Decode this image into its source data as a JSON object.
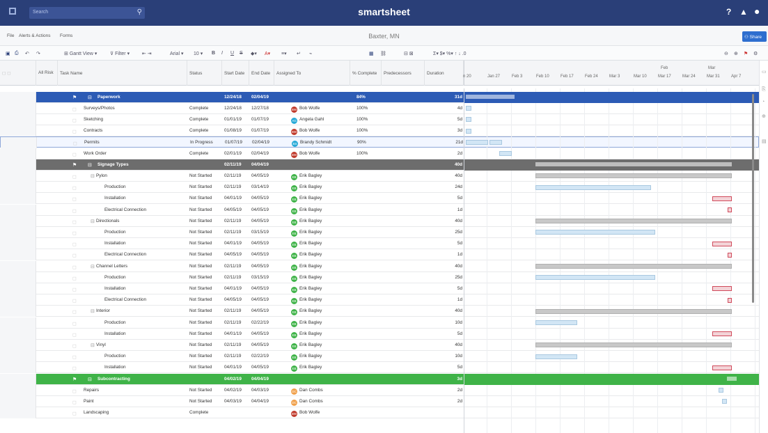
{
  "topbar": {
    "search_placeholder": "Search",
    "app_name": "smartsheet",
    "icons": [
      "grid-icon",
      "search-icon",
      "help-icon",
      "bell-icon",
      "profile-icon"
    ]
  },
  "menu": {
    "items": [
      "File",
      "Alerts & Actions",
      "Forms"
    ],
    "sheet_title": "Baxter, MN",
    "share_label": "Share"
  },
  "toolbar": {
    "gantt_view": "Gantt View",
    "filter": "Filter",
    "font": "Arial",
    "font_size": "10"
  },
  "columns": [
    "All Risk",
    "Task Name",
    "Status",
    "Start Date",
    "End Date",
    "Assigned To",
    "% Complete",
    "Predecessors",
    "Duration"
  ],
  "gantt_header": {
    "months": [
      "Feb",
      "Mar"
    ],
    "weeks": [
      "n 20",
      "Jan 27",
      "Feb 3",
      "Feb 10",
      "Feb 17",
      "Feb 24",
      "Mar 3",
      "Mar 10",
      "Mar 17",
      "Mar 24",
      "Mar 31",
      "Apr 7"
    ]
  },
  "rows": [
    {
      "type": "p1",
      "name": "Paperwork",
      "status": "",
      "start": "12/24/18",
      "end": "02/04/19",
      "assigned": "",
      "pct": "84%",
      "dur": "31d"
    },
    {
      "type": "c",
      "name": "Surveys/Photos",
      "status": "Complete",
      "start": "12/24/18",
      "end": "12/27/18",
      "assigned": "Bob Wolfe",
      "avc": "#c0392b",
      "pct": "100%",
      "dur": "4d"
    },
    {
      "type": "c",
      "name": "Sketching",
      "status": "Complete",
      "start": "01/01/19",
      "end": "01/07/19",
      "assigned": "Angela Gahl",
      "avc": "#27a9d7",
      "pct": "100%",
      "dur": "5d"
    },
    {
      "type": "c",
      "name": "Contracts",
      "status": "Complete",
      "start": "01/08/19",
      "end": "01/07/19",
      "assigned": "Bob Wolfe",
      "avc": "#c0392b",
      "pct": "100%",
      "dur": "3d"
    },
    {
      "type": "c",
      "sel": true,
      "name": "Permits",
      "status": "In Progress",
      "start": "01/07/19",
      "end": "02/04/19",
      "assigned": "Brandy Schmidt",
      "avc": "#27a9d7",
      "pct": "90%",
      "dur": "21d"
    },
    {
      "type": "c",
      "name": "Work Order",
      "status": "Complete",
      "start": "02/01/19",
      "end": "02/04/19",
      "assigned": "Bob Wolfe",
      "avc": "#c0392b",
      "pct": "100%",
      "dur": "2d"
    },
    {
      "type": "p2",
      "name": "Signage Types",
      "status": "",
      "start": "02/11/19",
      "end": "04/04/19",
      "assigned": "",
      "pct": "",
      "dur": "40d"
    },
    {
      "type": "c",
      "indent": 1,
      "name": "Pylon",
      "status": "Not Started",
      "start": "02/11/19",
      "end": "04/05/19",
      "assigned": "Erik Bagley",
      "avc": "#3fb348",
      "pct": "",
      "dur": "40d"
    },
    {
      "type": "c",
      "indent": 2,
      "name": "Production",
      "status": "Not Started",
      "start": "02/11/19",
      "end": "03/14/19",
      "assigned": "Erik Bagley",
      "avc": "#3fb348",
      "pct": "",
      "dur": "24d"
    },
    {
      "type": "c",
      "indent": 2,
      "name": "Installation",
      "status": "Not Started",
      "start": "04/01/19",
      "end": "04/05/19",
      "assigned": "Erik Bagley",
      "avc": "#3fb348",
      "pct": "",
      "dur": "5d"
    },
    {
      "type": "c",
      "indent": 2,
      "name": "Electrical Connection",
      "status": "Not Started",
      "start": "04/05/19",
      "end": "04/05/19",
      "assigned": "Erik Bagley",
      "avc": "#3fb348",
      "pct": "",
      "dur": "1d"
    },
    {
      "type": "c",
      "indent": 1,
      "name": "Directionals",
      "status": "Not Started",
      "start": "02/11/19",
      "end": "04/05/19",
      "assigned": "Erik Bagley",
      "avc": "#3fb348",
      "pct": "",
      "dur": "40d"
    },
    {
      "type": "c",
      "indent": 2,
      "name": "Production",
      "status": "Not Started",
      "start": "02/11/19",
      "end": "03/15/19",
      "assigned": "Erik Bagley",
      "avc": "#3fb348",
      "pct": "",
      "dur": "25d"
    },
    {
      "type": "c",
      "indent": 2,
      "name": "Installation",
      "status": "Not Started",
      "start": "04/01/19",
      "end": "04/05/19",
      "assigned": "Erik Bagley",
      "avc": "#3fb348",
      "pct": "",
      "dur": "5d"
    },
    {
      "type": "c",
      "indent": 2,
      "name": "Electrical Connection",
      "status": "Not Started",
      "start": "04/05/19",
      "end": "04/05/19",
      "assigned": "Erik Bagley",
      "avc": "#3fb348",
      "pct": "",
      "dur": "1d"
    },
    {
      "type": "c",
      "indent": 1,
      "name": "Channel Letters",
      "status": "Not Started",
      "start": "02/11/19",
      "end": "04/05/19",
      "assigned": "Erik Bagley",
      "avc": "#3fb348",
      "pct": "",
      "dur": "40d"
    },
    {
      "type": "c",
      "indent": 2,
      "name": "Production",
      "status": "Not Started",
      "start": "02/11/19",
      "end": "03/15/19",
      "assigned": "Erik Bagley",
      "avc": "#3fb348",
      "pct": "",
      "dur": "25d"
    },
    {
      "type": "c",
      "indent": 2,
      "name": "Installation",
      "status": "Not Started",
      "start": "04/01/19",
      "end": "04/05/19",
      "assigned": "Erik Bagley",
      "avc": "#3fb348",
      "pct": "",
      "dur": "5d"
    },
    {
      "type": "c",
      "indent": 2,
      "name": "Electrical Connection",
      "status": "Not Started",
      "start": "04/05/19",
      "end": "04/05/19",
      "assigned": "Erik Bagley",
      "avc": "#3fb348",
      "pct": "",
      "dur": "1d"
    },
    {
      "type": "c",
      "indent": 1,
      "name": "Interior",
      "status": "Not Started",
      "start": "02/11/19",
      "end": "04/05/19",
      "assigned": "Erik Bagley",
      "avc": "#3fb348",
      "pct": "",
      "dur": "40d"
    },
    {
      "type": "c",
      "indent": 2,
      "name": "Production",
      "status": "Not Started",
      "start": "02/11/19",
      "end": "02/22/19",
      "assigned": "Erik Bagley",
      "avc": "#3fb348",
      "pct": "",
      "dur": "10d"
    },
    {
      "type": "c",
      "indent": 2,
      "name": "Installation",
      "status": "Not Started",
      "start": "04/01/19",
      "end": "04/05/19",
      "assigned": "Erik Bagley",
      "avc": "#3fb348",
      "pct": "",
      "dur": "5d"
    },
    {
      "type": "c",
      "indent": 1,
      "name": "Vinyl",
      "status": "Not Started",
      "start": "02/11/19",
      "end": "04/05/19",
      "assigned": "Erik Bagley",
      "avc": "#3fb348",
      "pct": "",
      "dur": "40d"
    },
    {
      "type": "c",
      "indent": 2,
      "name": "Production",
      "status": "Not Started",
      "start": "02/11/19",
      "end": "02/22/19",
      "assigned": "Erik Bagley",
      "avc": "#3fb348",
      "pct": "",
      "dur": "10d"
    },
    {
      "type": "c",
      "indent": 2,
      "name": "Installation",
      "status": "Not Started",
      "start": "04/01/19",
      "end": "04/05/19",
      "assigned": "Erik Bagley",
      "avc": "#3fb348",
      "pct": "",
      "dur": "5d"
    },
    {
      "type": "p3",
      "name": "Subcontracting",
      "status": "",
      "start": "04/02/19",
      "end": "04/04/19",
      "assigned": "",
      "pct": "",
      "dur": "3d"
    },
    {
      "type": "c",
      "name": "Repairs",
      "status": "Not Started",
      "start": "04/02/19",
      "end": "04/03/19",
      "assigned": "Dan Combs",
      "avc": "#f0a04b",
      "pct": "",
      "dur": "2d"
    },
    {
      "type": "c",
      "name": "Paint",
      "status": "Not Started",
      "start": "04/03/19",
      "end": "04/04/19",
      "assigned": "Dan Combs",
      "avc": "#f0a04b",
      "pct": "",
      "dur": "2d"
    },
    {
      "type": "c",
      "name": "Landscaping",
      "status": "Complete",
      "start": "",
      "end": "",
      "assigned": "Bob Wolfe",
      "avc": "#c0392b",
      "pct": "",
      "dur": ""
    }
  ]
}
